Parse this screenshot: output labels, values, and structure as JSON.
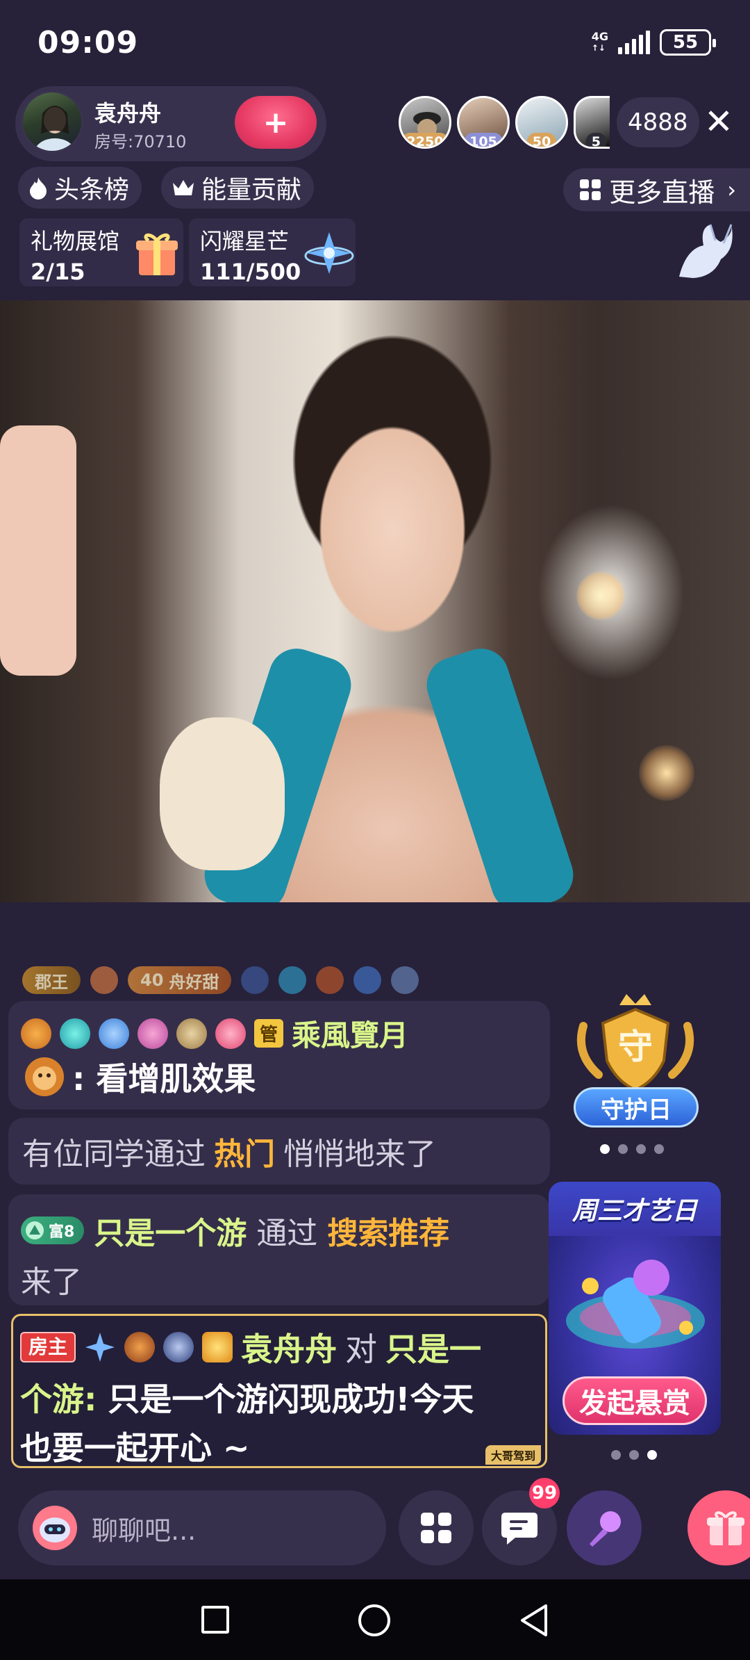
{
  "status_bar": {
    "time": "09:09",
    "network": "4G",
    "battery": "55"
  },
  "host": {
    "name": "袁舟舟",
    "room_no": "房号:70710",
    "follow_label": "+"
  },
  "viewers": [
    {
      "count": "2250",
      "color": "#d9a35a"
    },
    {
      "count": "105",
      "color": "#8d8fd6"
    },
    {
      "count": "50",
      "color": "#d9a35a"
    },
    {
      "count": "5",
      "color": "#555566"
    }
  ],
  "viewer_total": "4888",
  "close_label": "✕",
  "chips": {
    "headline": "头条榜",
    "energy": "能量贡献",
    "more_live": "更多直播"
  },
  "cards": [
    {
      "title": "礼物展馆",
      "progress": "2/15"
    },
    {
      "title": "闪耀星芒",
      "progress": "111/500"
    }
  ],
  "chat": {
    "top_badges": {
      "rank": "郡王",
      "level": "40",
      "fan": "舟好甜"
    },
    "msg1": {
      "admin_tag": "管",
      "user": "乘風覽月",
      "text": ": 看增肌效果"
    },
    "msg2": {
      "prefix": "有位同学通过",
      "source": "热门",
      "suffix": "悄悄地来了"
    },
    "msg3": {
      "rich_label": "富8",
      "user": "只是一个游",
      "mid": "通过",
      "source": "搜索推荐",
      "suffix": "来了"
    },
    "host_msg": {
      "tag": "房主",
      "user": "袁舟舟",
      "mid": "对",
      "target_a": "只是一",
      "target_b": "个游:",
      "text_a": "只是一个游闪现成功!今天",
      "text_b": "也要一起开心 ~",
      "stamp": "大哥驾到"
    }
  },
  "guard": {
    "icon_char": "守",
    "label": "守护日"
  },
  "promo": {
    "title": "周三才艺日",
    "button": "发起悬赏"
  },
  "bottom": {
    "input_placeholder": "聊聊吧...",
    "badge": "99"
  },
  "colors": {
    "background": "#27213a",
    "accent_orange": "#ffb63a",
    "accent_green": "#d9f58a",
    "host_border": "#e8c06a"
  }
}
